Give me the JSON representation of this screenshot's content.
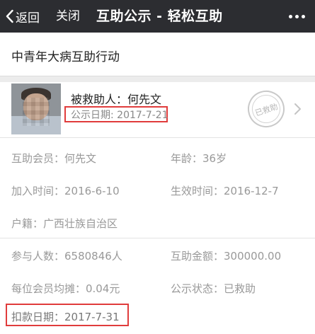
{
  "navbar": {
    "back_label": "返回",
    "close_label": "关闭",
    "title": "互助公示 - 轻松互助",
    "more_icon": "more-dots-icon"
  },
  "activity": {
    "title": "中青年大病互助行动"
  },
  "person": {
    "name_line": "被救助人：何先文",
    "publish_date": "公示日期: 2017-7-21",
    "stamp_text": "已救助"
  },
  "member_info": {
    "member": "互助会员：何先文",
    "age": "年龄：36岁",
    "join_time": "加入时间：2016-6-10",
    "effective_time": "生效时间：2016-12-7",
    "household": "户籍：广西壮族自治区"
  },
  "payout_info": {
    "participants": "参与人数：6580846人",
    "amount": "互助金额：300000.00",
    "per_member": "每位会员均摊：0.04元",
    "status": "公示状态：已救助",
    "deduct_date": "扣款日期：2017-7-31"
  },
  "colors": {
    "navbar_bg": "#2c2d31",
    "highlight_red": "#e03c3c",
    "label_gray": "#999999",
    "divider_gray": "#e3e3e3"
  }
}
